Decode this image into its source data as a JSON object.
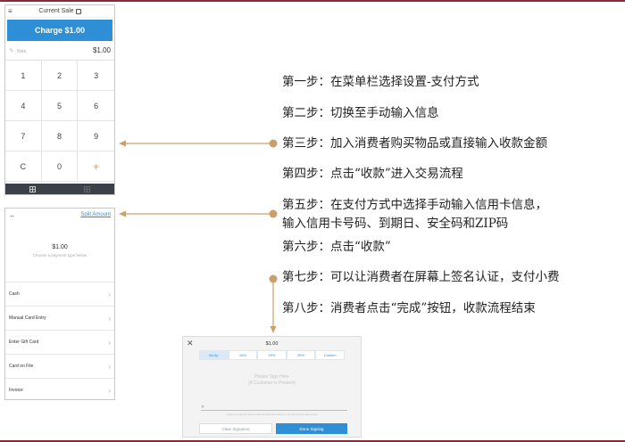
{
  "current_sale": {
    "title": "Current Sale",
    "charge_label": "Charge $1.00",
    "note_placeholder": "Note",
    "amount": "$1.00",
    "keypad": [
      "1",
      "2",
      "3",
      "4",
      "5",
      "6",
      "7",
      "8",
      "9",
      "C",
      "0",
      "+"
    ]
  },
  "payment": {
    "split_label": "Split Amount",
    "amount": "$1.00",
    "subtitle": "Choose a payment type below",
    "options": [
      "Cash",
      "Manual Card Entry",
      "Enter Gift Card",
      "Card on File",
      "Invoice"
    ]
  },
  "signature": {
    "amount": "$1.00",
    "tips": [
      "No tip",
      "15%",
      "20%",
      "25%",
      "Custom"
    ],
    "placeholder_line1": "Please Sign Here",
    "placeholder_line2": "(If Customer is Present)",
    "fine_print": "I agree to pay the above total amount according to my card issuer agreement",
    "clear_label": "Clear Signature",
    "done_label": "Done Signing"
  },
  "steps": [
    "第一步：在菜单栏选择设置-支付方式",
    "第二步：切换至手动输入信息",
    "第三步：加入消费者购买物品或直接输入收款金额",
    "第四步：点击“收款”进入交易流程",
    "第五步：在支付方式中选择手动输入信用卡信息，",
    "输入信用卡号码、到期日、安全码和ZIP码",
    "第六步：点击“收款”",
    "第七步：可以让消费者在屏幕上签名认证，支付小费",
    "第八步：消费者点击“完成”按钮，收款流程结束"
  ],
  "colors": {
    "accent": "#2e8fd6",
    "arrow": "#c9a06a",
    "frame": "#8a2a3a",
    "plus": "#f39c12"
  }
}
